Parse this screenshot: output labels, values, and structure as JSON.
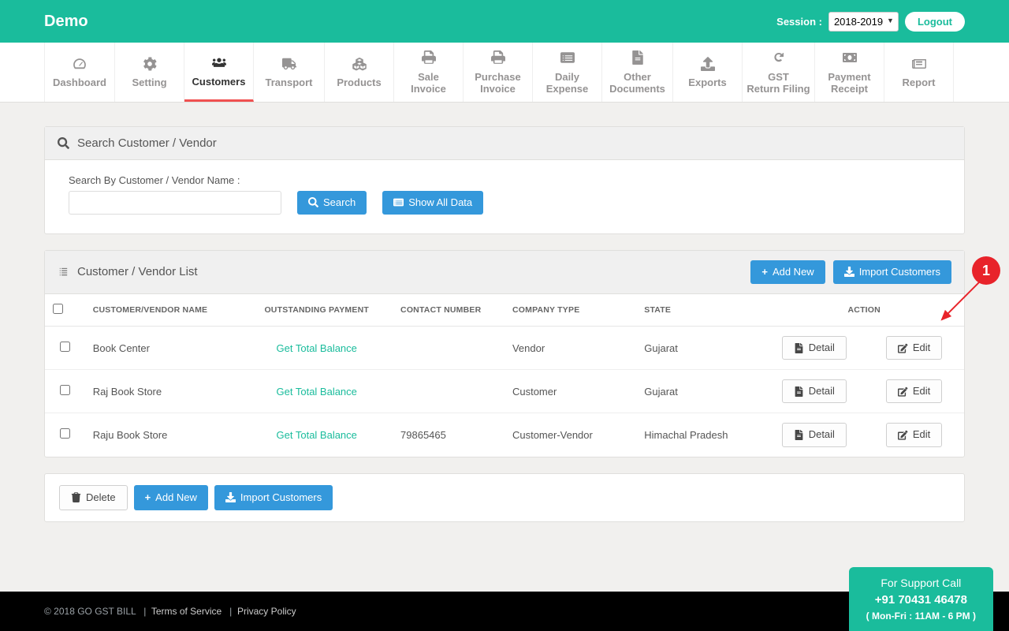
{
  "brand": "Demo",
  "session_label": "Session :",
  "session_value": "2018-2019",
  "logout": "Logout",
  "nav": [
    {
      "key": "dashboard",
      "label": "Dashboard"
    },
    {
      "key": "setting",
      "label": "Setting"
    },
    {
      "key": "customers",
      "label": "Customers"
    },
    {
      "key": "transport",
      "label": "Transport"
    },
    {
      "key": "products",
      "label": "Products"
    },
    {
      "key": "sale-invoice",
      "label": "Sale\nInvoice"
    },
    {
      "key": "purchase-invoice",
      "label": "Purchase\nInvoice"
    },
    {
      "key": "daily-expense",
      "label": "Daily\nExpense"
    },
    {
      "key": "other-documents",
      "label": "Other\nDocuments"
    },
    {
      "key": "exports",
      "label": "Exports"
    },
    {
      "key": "gst-return",
      "label": "GST\nReturn Filing"
    },
    {
      "key": "payment-receipt",
      "label": "Payment\nReceipt"
    },
    {
      "key": "report",
      "label": "Report"
    }
  ],
  "search_panel": {
    "title": "Search Customer / Vendor",
    "field_label": "Search By Customer / Vendor Name :",
    "search_btn": "Search",
    "show_all_btn": "Show All Data"
  },
  "list_panel": {
    "title": "Customer / Vendor List",
    "add_new": "Add New",
    "import": "Import Customers",
    "columns": {
      "name": "CUSTOMER/VENDOR NAME",
      "outstanding": "OUTSTANDING PAYMENT",
      "contact": "CONTACT NUMBER",
      "company_type": "COMPANY TYPE",
      "state": "STATE",
      "action": "ACTION"
    },
    "balance_link": "Get Total Balance",
    "detail_btn": "Detail",
    "edit_btn": "Edit",
    "rows": [
      {
        "name": "Book Center",
        "contact": "",
        "type": "Vendor",
        "state": "Gujarat"
      },
      {
        "name": "Raj Book Store",
        "contact": "",
        "type": "Customer",
        "state": "Gujarat"
      },
      {
        "name": "Raju Book Store",
        "contact": "79865465",
        "type": "Customer-Vendor",
        "state": "Himachal Pradesh"
      }
    ]
  },
  "bottom_actions": {
    "delete": "Delete",
    "add_new": "Add New",
    "import": "Import Customers"
  },
  "footer": {
    "copyright": "© 2018 GO GST BILL",
    "tos": "Terms of Service",
    "privacy": "Privacy Policy"
  },
  "support": {
    "line1": "For Support Call",
    "phone": "+91 70431 46478",
    "hours": "( Mon-Fri : 11AM - 6 PM )"
  },
  "annotation": {
    "number": "1"
  }
}
